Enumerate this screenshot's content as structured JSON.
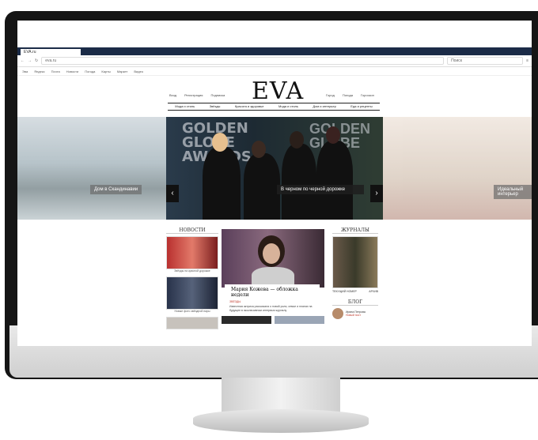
{
  "browser": {
    "tab_title": "EVA.ru",
    "url": "eva.ru",
    "search_placeholder": "Поиск",
    "bookmarks": [
      "Эва",
      "Яндекс",
      "Почта",
      "Новости",
      "Погода",
      "Карты",
      "Маркет",
      "Видео"
    ]
  },
  "site": {
    "logo": "EVA",
    "small_nav_left": [
      "Вход",
      "Регистрация",
      "Подписка"
    ],
    "small_nav_right": [
      "Город",
      "Погода",
      "Гороскоп"
    ],
    "main_nav": [
      "Мода и стиль",
      "Звёзды",
      "Красота и здоровье",
      "Мода и стиль",
      "Дом и интерьер",
      "Еда и рецепты"
    ]
  },
  "hero": {
    "left_caption": "Дом в Скандинавии",
    "main_caption": "В черном по черной дорожке",
    "gg_text": "GOLDEN GLOBE AWARDS",
    "right_caption": "Идеальный интерьер"
  },
  "columns": {
    "left_header": "НОВОСТИ",
    "left_items": [
      "Звёзды на красной дорожке",
      "Новые фото звёздной пары"
    ],
    "center_title": "Мария Кожева — обложка недели",
    "center_tag": "ЗВЁЗДЫ",
    "center_text": "Известная актриса рассказала о новой роли, семье и планах на будущее в эксклюзивном интервью журналу",
    "right_header": "ЖУРНАЛЫ",
    "right_links": [
      "ТЕКУЩИЙ НОМЕР",
      "АРХИВ"
    ],
    "blog_header": "БЛОГ",
    "blog_author": "Ирина Петрова",
    "blog_label": "Новый пост"
  }
}
